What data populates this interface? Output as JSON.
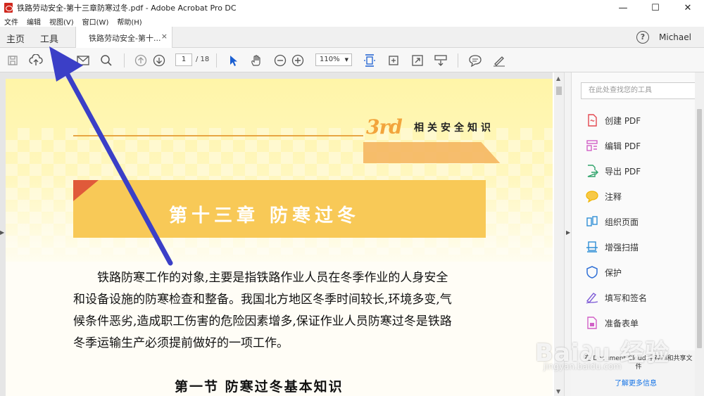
{
  "window": {
    "title": "铁路劳动安全-第十三章防寒过冬.pdf - Adobe Acrobat Pro DC",
    "minimize": "—",
    "maximize": "☐",
    "close": "✕"
  },
  "menu": [
    "文件",
    "编辑",
    "视图(V)",
    "窗口(W)",
    "帮助(H)"
  ],
  "tabs": {
    "home": "主页",
    "tools": "工具",
    "document": "铁路劳动安全-第十...",
    "close": "×",
    "help": "?",
    "user": "Michael"
  },
  "toolbar": {
    "page_current": "1",
    "page_total": "/ 18",
    "zoom": "110%",
    "zoom_arrow": "▼",
    "icons": [
      "save-icon",
      "upload-icon",
      "print-icon",
      "email-icon",
      "search-icon",
      "page-up-icon",
      "page-down-icon",
      "select-cursor-icon",
      "hand-icon",
      "zoom-out-icon",
      "zoom-in-icon",
      "fit-page-icon",
      "rotate-page-icon",
      "fullscreen-icon",
      "scroll-mode-icon",
      "comment-icon",
      "sign-icon"
    ]
  },
  "document": {
    "header_mark": "3rd",
    "header_section": "相关安全知识",
    "chapter_title": "第十三章  防寒过冬",
    "paragraph": [
      "铁路防寒工作的对象,主要是指铁路作业人员在冬季作业的人身安全",
      "和设备设施的防寒检查和整备。我国北方地区冬季时间较长,环境多变,气",
      "候条件恶劣,造成职工伤害的危险因素增多,保证作业人员防寒过冬是铁路",
      "冬季运输生产必须提前做好的一项工作。"
    ],
    "section_heading": "第一节   防寒过冬基本知识"
  },
  "tools_pane": {
    "search_placeholder": "在此处查找您的工具",
    "items": [
      {
        "label": "创建 PDF",
        "icon": "create-pdf-icon",
        "color": "#e34850"
      },
      {
        "label": "编辑 PDF",
        "icon": "edit-pdf-icon",
        "color": "#d160c6"
      },
      {
        "label": "导出 PDF",
        "icon": "export-pdf-icon",
        "color": "#2fa36b"
      },
      {
        "label": "注释",
        "icon": "comment-icon",
        "color": "#f0b400"
      },
      {
        "label": "组织页面",
        "icon": "organize-pages-icon",
        "color": "#2f8fd6"
      },
      {
        "label": "增强扫描",
        "icon": "enhance-scan-icon",
        "color": "#2f8fd6"
      },
      {
        "label": "保护",
        "icon": "protect-icon",
        "color": "#2f6fd6"
      },
      {
        "label": "填写和签名",
        "icon": "fill-sign-icon",
        "color": "#7e5bd6"
      },
      {
        "label": "准备表单",
        "icon": "prepare-form-icon",
        "color": "#d160c6"
      }
    ],
    "footer_message": "在 Document Cloud 中存储和共享文件",
    "footer_link": "了解更多信息"
  },
  "watermark": {
    "main": "Bai∂u 经验",
    "sub": "jingyan.baidu.com"
  },
  "colors": {
    "accent": "#1473e6",
    "annotation_arrow": "#3b3fc7",
    "chapter_banner": "#f8c957"
  }
}
